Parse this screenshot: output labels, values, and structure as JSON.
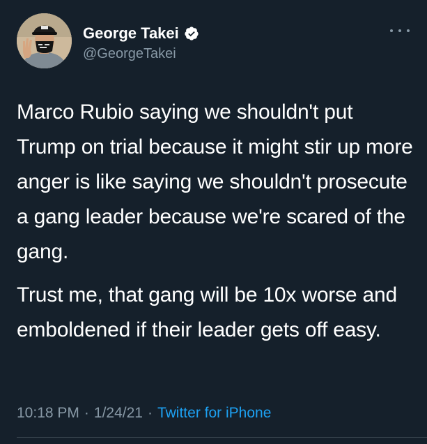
{
  "author": {
    "display_name": "George Takei",
    "handle": "@GeorgeTakei",
    "verified": true,
    "avatar_icon": "profile-photo",
    "verified_icon": "verified-badge-icon"
  },
  "menu": {
    "icon": "more-options-icon"
  },
  "tweet": {
    "paragraphs": [
      "Marco Rubio saying we shouldn't put Trump on trial because it might stir up more anger is like saying we shouldn't prosecute a gang leader because we're scared of the gang.",
      "Trust me, that gang will be 10x worse and emboldened if their leader gets off easy."
    ]
  },
  "meta": {
    "time": "10:18 PM",
    "separator": "·",
    "date": "1/24/21",
    "source": "Twitter for iPhone"
  },
  "colors": {
    "background": "#15202b",
    "text": "#ffffff",
    "secondary_text": "#8899a6",
    "link": "#1da1f2",
    "divider": "#38444d"
  }
}
